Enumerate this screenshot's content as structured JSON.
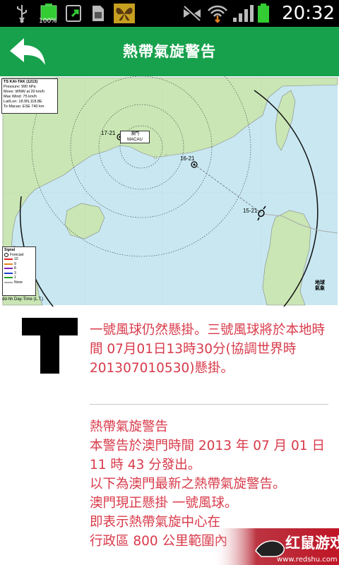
{
  "status_bar": {
    "battery_percent_label": "100%",
    "time": "20:32",
    "icons": [
      "usb-icon",
      "battery-full-icon",
      "sync-icon",
      "sim-card-icon",
      "butterfly-app-icon",
      "mute-icon",
      "wifi-icon",
      "signal-strength-icon",
      "battery-icon"
    ]
  },
  "header": {
    "title": "熱帶氣旋警告",
    "back_icon": "back-arrow-icon"
  },
  "map": {
    "info": {
      "name": "TS KAI-TAK (1213)",
      "pressure": "Pressure: 990 hPa",
      "move": "Move: WNW at 20 km/h",
      "max_wind": "Max Wind: 75 km/h",
      "latlon": "Lat/Lon: 18.9N,118.8E",
      "to_macao": "To Macao: ESE  740 km"
    },
    "macau_label": "澳門\nMACAU",
    "time_labels": [
      "17-21",
      "16-21",
      "15-21"
    ],
    "legend": {
      "title": "Signal",
      "forecast": "Forecast",
      "items": [
        {
          "label": "10",
          "color": "#e02020"
        },
        {
          "label": "9",
          "color": "#e08020"
        },
        {
          "label": "8",
          "color": "#8020c0"
        },
        {
          "label": "3",
          "color": "#2040d0"
        },
        {
          "label": "1",
          "color": "#20a020"
        },
        {
          "label": "None",
          "color": "#aaaaaa"
        }
      ]
    },
    "footer": "dd-hh  Day-Time (L.T.)",
    "logo": "地球\n氣象"
  },
  "content": {
    "tile_letter": "T",
    "signal_message": "一號風球仍然懸掛。三號風球將於本地時間 07月01日13時30分(協調世界時 201307010530)懸掛。",
    "bulletin": [
      "熱帶氣旋警告",
      "本警告於澳門時間 2013 年 07 月 01 日 11 時 43 分發出。",
      "以下為澳門最新之熱帶氣旋警告。",
      "澳門現正懸掛 一號風球。",
      "即表示熱帶氣旋中心在",
      "行政區 800 公里範圍內"
    ]
  },
  "watermark": {
    "brand": "红鼠游戏",
    "url": "www.redshu.com"
  }
}
